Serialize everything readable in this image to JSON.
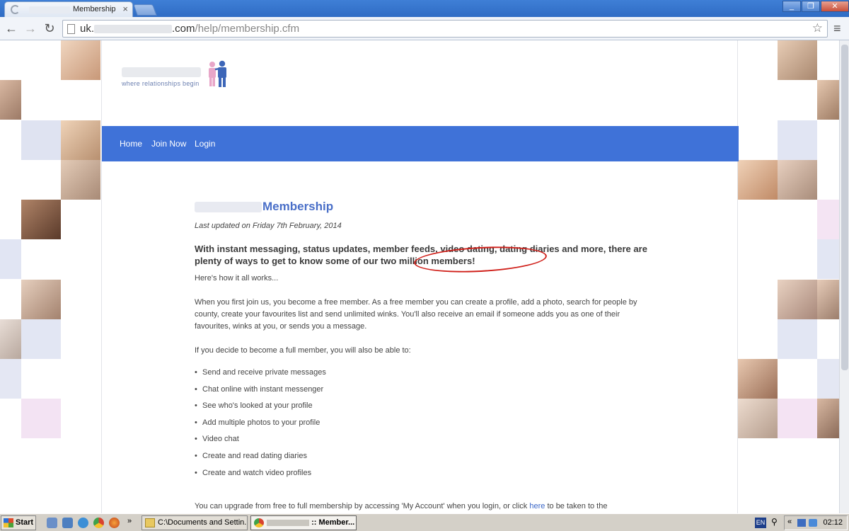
{
  "browser": {
    "tab_title": "Membership",
    "tab_close": "×",
    "url_prefix": "uk.",
    "url_domain_end": ".com",
    "url_path": "/help/membership.cfm",
    "window_buttons": [
      "_",
      "❐",
      "✕"
    ]
  },
  "site": {
    "tagline": "where relationships begin",
    "nav": [
      "Home",
      "Join Now",
      "Login"
    ]
  },
  "article": {
    "title": "Membership",
    "updated": "Last updated on Friday 7th February, 2014",
    "lead": "With instant messaging, status updates, member feeds, video dating, dating diaries and more, there are plenty of ways to get to know some of our two million members!",
    "how": "Here's how it all works...",
    "intro": "When you first join us, you become a free member. As a free member you can create a profile, add a photo, search for people by county, create your favourites list and send unlimited winks. You'll also receive an email if someone adds you as one of their favourites, winks at you, or sends you a message.",
    "decide": "If you decide to become a full member, you will also be able to:",
    "features": [
      "Send and receive private messages",
      "Chat online with instant messenger",
      "See who's looked at your profile",
      "Add multiple photos to your profile",
      "Video chat",
      "Create and read dating diaries",
      "Create and watch video profiles"
    ],
    "upgrade_before": "You can upgrade from free to full membership by accessing 'My Account' when you login, or click ",
    "upgrade_link": "here",
    "upgrade_after": " to be taken to the"
  },
  "taskbar": {
    "start": "Start",
    "explorer_task": "C:\\Documents and Settin...",
    "browser_task": ":: Member...",
    "lang": "EN",
    "clock": "02:12"
  },
  "colors": {
    "nav_band": "#3f72d8",
    "title_blue": "#4a6fc8",
    "highlight_circle": "#d0201a"
  }
}
